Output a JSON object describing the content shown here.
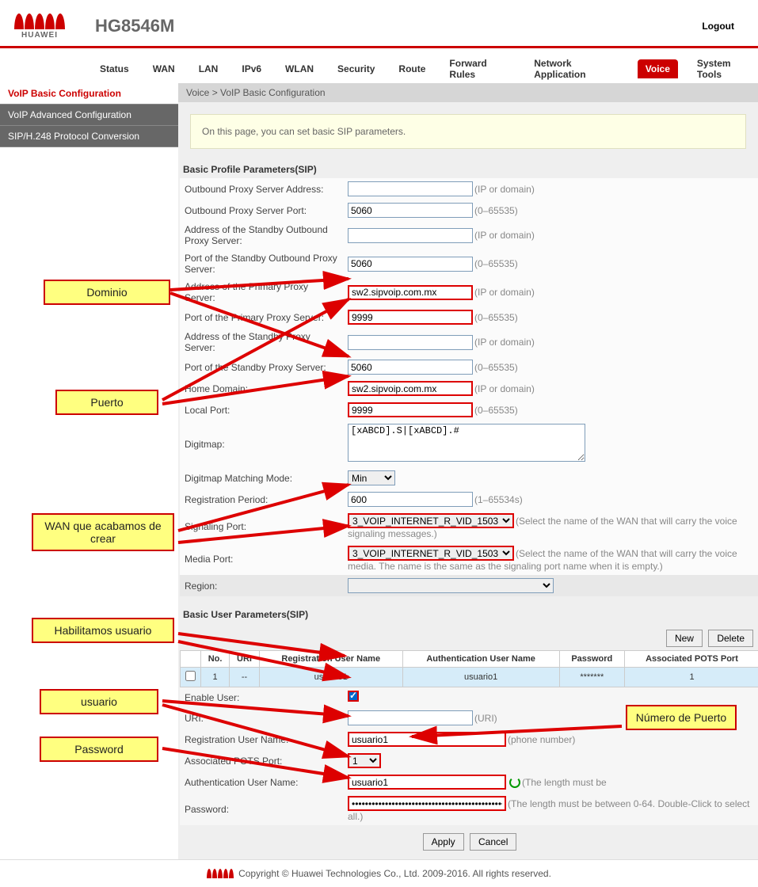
{
  "header": {
    "model": "HG8546M",
    "logout": "Logout",
    "brand": "HUAWEI"
  },
  "tabs": [
    "Status",
    "WAN",
    "LAN",
    "IPv6",
    "WLAN",
    "Security",
    "Route",
    "Forward Rules",
    "Network Application",
    "Voice",
    "System Tools"
  ],
  "active_tab": "Voice",
  "sidebar": [
    {
      "label": "VoIP Basic Configuration",
      "active": true
    },
    {
      "label": "VoIP Advanced Configuration",
      "active": false
    },
    {
      "label": "SIP/H.248 Protocol Conversion",
      "active": false
    }
  ],
  "crumb": "Voice > VoIP Basic Configuration",
  "info": "On this page, you can set basic SIP parameters.",
  "sect1": "Basic Profile Parameters(SIP)",
  "fields": {
    "outproxy_addr": {
      "label": "Outbound Proxy Server Address:",
      "value": "",
      "hint": "(IP or domain)"
    },
    "outproxy_port": {
      "label": "Outbound Proxy Server Port:",
      "value": "5060",
      "hint": "(0–65535)"
    },
    "stdby_outproxy_addr": {
      "label": "Address of the Standby Outbound Proxy Server:",
      "value": "",
      "hint": "(IP or domain)"
    },
    "stdby_outproxy_port": {
      "label": "Port of the Standby Outbound Proxy Server:",
      "value": "5060",
      "hint": "(0–65535)"
    },
    "prim_proxy_addr": {
      "label": "Address of the Primary Proxy Server:",
      "value": "sw2.sipvoip.com.mx",
      "hint": "(IP or domain)",
      "hl": true
    },
    "prim_proxy_port": {
      "label": "Port of the Primary Proxy Server:",
      "value": "9999",
      "hint": "(0–65535)",
      "hl": true
    },
    "stdby_proxy_addr": {
      "label": "Address of the Standby Proxy Server:",
      "value": "",
      "hint": "(IP or domain)"
    },
    "stdby_proxy_port": {
      "label": "Port of the Standby Proxy Server:",
      "value": "5060",
      "hint": "(0–65535)"
    },
    "home_domain": {
      "label": "Home Domain:",
      "value": "sw2.sipvoip.com.mx",
      "hint": "(IP or domain)",
      "hl": true
    },
    "local_port": {
      "label": "Local Port:",
      "value": "9999",
      "hint": "(0–65535)",
      "hl": true
    },
    "digitmap": {
      "label": "Digitmap:",
      "value": "[xABCD].S|[xABCD].#"
    },
    "digitmap_mode": {
      "label": "Digitmap Matching Mode:",
      "value": "Min"
    },
    "reg_period": {
      "label": "Registration Period:",
      "value": "600",
      "hint": "(1–65534s)"
    },
    "sig_port": {
      "label": "Signaling Port:",
      "value": "3_VOIP_INTERNET_R_VID_1503",
      "hint": "(Select the name of the WAN that will carry the voice signaling messages.)"
    },
    "media_port": {
      "label": "Media Port:",
      "value": "3_VOIP_INTERNET_R_VID_1503",
      "hint": "(Select the name of the WAN that will carry the voice media. The name is the same as the signaling port name when it is empty.)"
    },
    "region": {
      "label": "Region:",
      "value": ""
    }
  },
  "sect2": "Basic User Parameters(SIP)",
  "buttons": {
    "new": "New",
    "delete": "Delete",
    "apply": "Apply",
    "cancel": "Cancel"
  },
  "utable": {
    "headers": [
      "",
      "No.",
      "URI",
      "Registration User Name",
      "Authentication User Name",
      "Password",
      "Associated POTS Port"
    ],
    "row": {
      "no": "1",
      "uri": "--",
      "reg": "usuario1",
      "auth": "usuario1",
      "pwd": "*******",
      "pots": "1"
    }
  },
  "detail": {
    "enable": {
      "label": "Enable User:"
    },
    "uri": {
      "label": "URI:",
      "value": "",
      "hint": "(URI)"
    },
    "regname": {
      "label": "Registration User Name:",
      "value": "usuario1",
      "hint": "(phone number)",
      "hl": true
    },
    "pots": {
      "label": "Associated POTS Port:",
      "value": "1",
      "hl": true
    },
    "authname": {
      "label": "Authentication User Name:",
      "value": "usuario1",
      "hint": "(The length must be",
      "hl": true
    },
    "pwd": {
      "label": "Password:",
      "value": "••••••••••••••••••••••••••••••••••••••••••••••••••••••••••••",
      "hint": "(The length must be between 0-64. Double-Click to select all.)",
      "hl": true
    }
  },
  "footer": "Copyright © Huawei Technologies Co., Ltd. 2009-2016. All rights reserved.",
  "callouts": {
    "dominio": "Dominio",
    "puerto": "Puerto",
    "wan": "WAN que acabamos de crear",
    "hab": "Habilitamos usuario",
    "usuario": "usuario",
    "password": "Password",
    "numpuerto": "Número de Puerto"
  }
}
